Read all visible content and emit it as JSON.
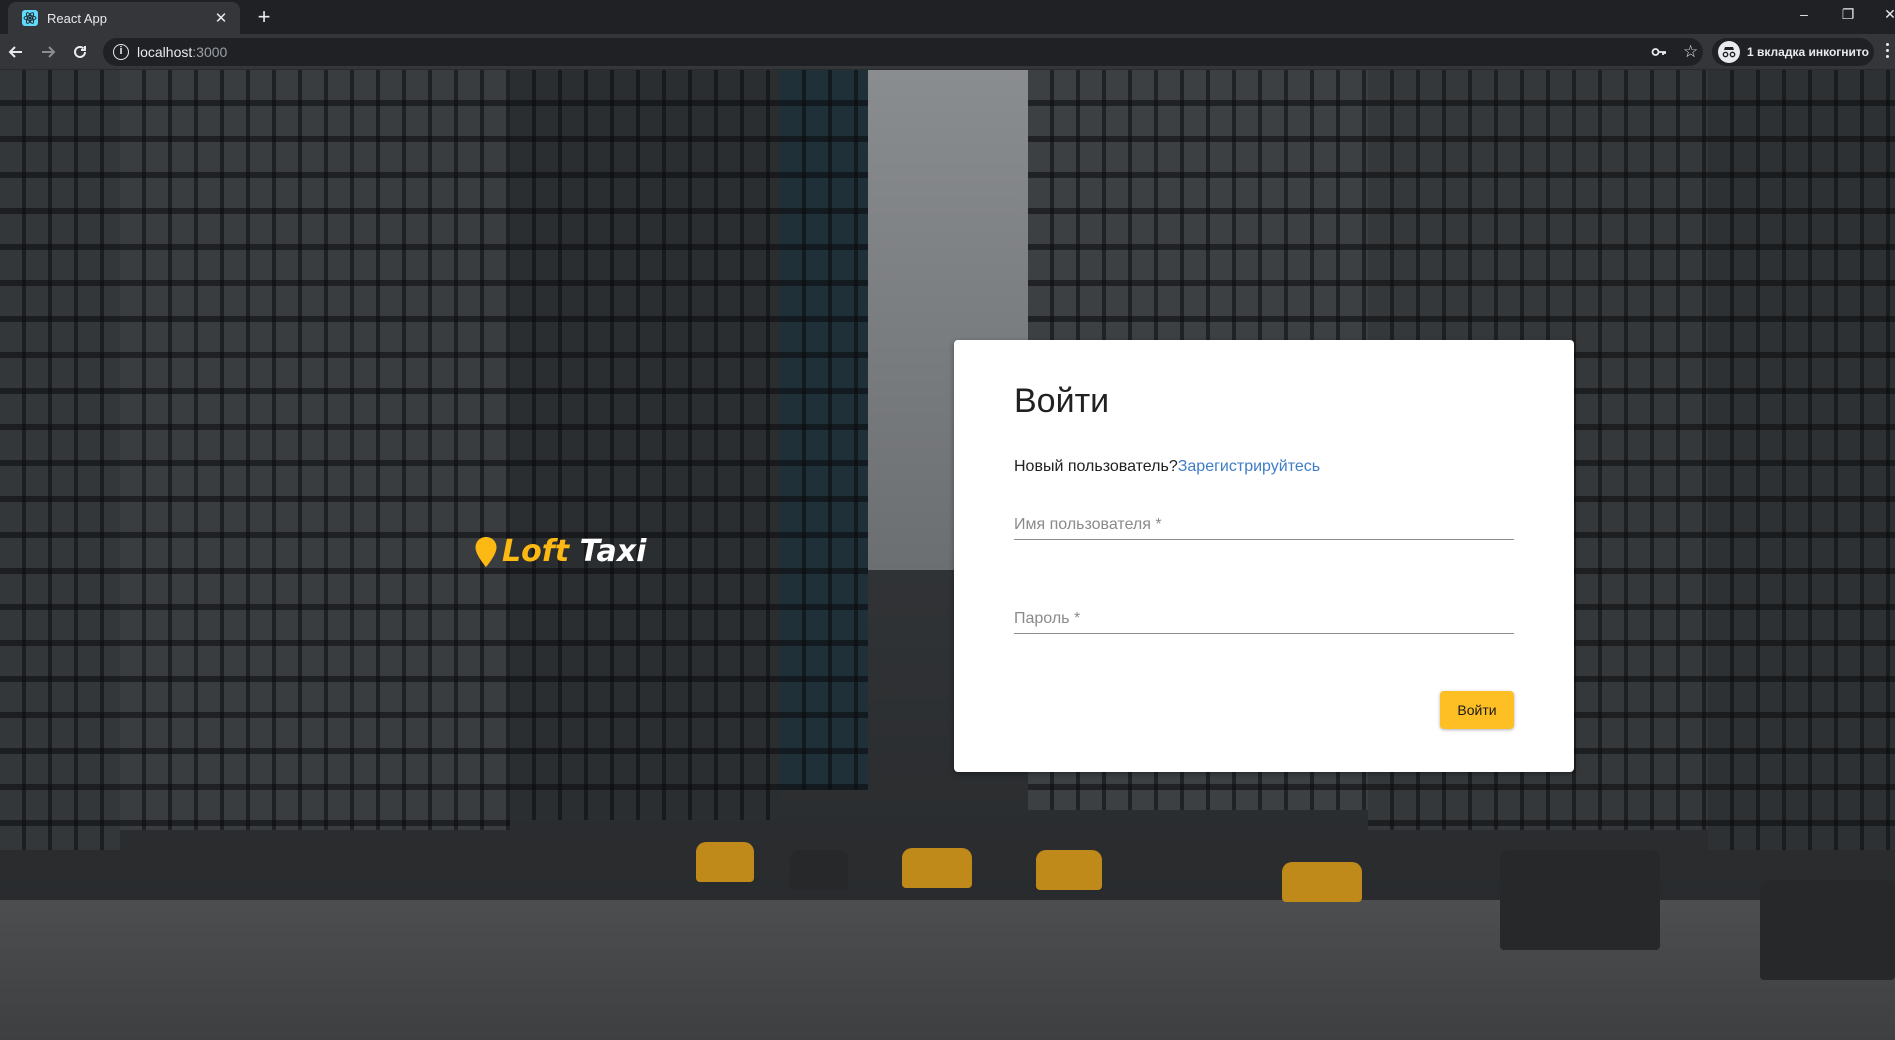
{
  "browser": {
    "tab_title": "React App",
    "url_host": "localhost",
    "url_port": ":3000",
    "incognito_label": "1 вкладка инкогнито"
  },
  "logo": {
    "word1": "Loft",
    "word2": "Taxi"
  },
  "login_card": {
    "title": "Войти",
    "new_user_text": "Новый пользователь?",
    "register_link": "Зарегистрируйтесь",
    "username_placeholder": "Имя пользователя *",
    "password_placeholder": "Пароль *",
    "submit_label": "Войти"
  },
  "colors": {
    "accent": "#fdbf24",
    "link": "#3f7dc7",
    "logo_yellow": "#fdb913"
  }
}
